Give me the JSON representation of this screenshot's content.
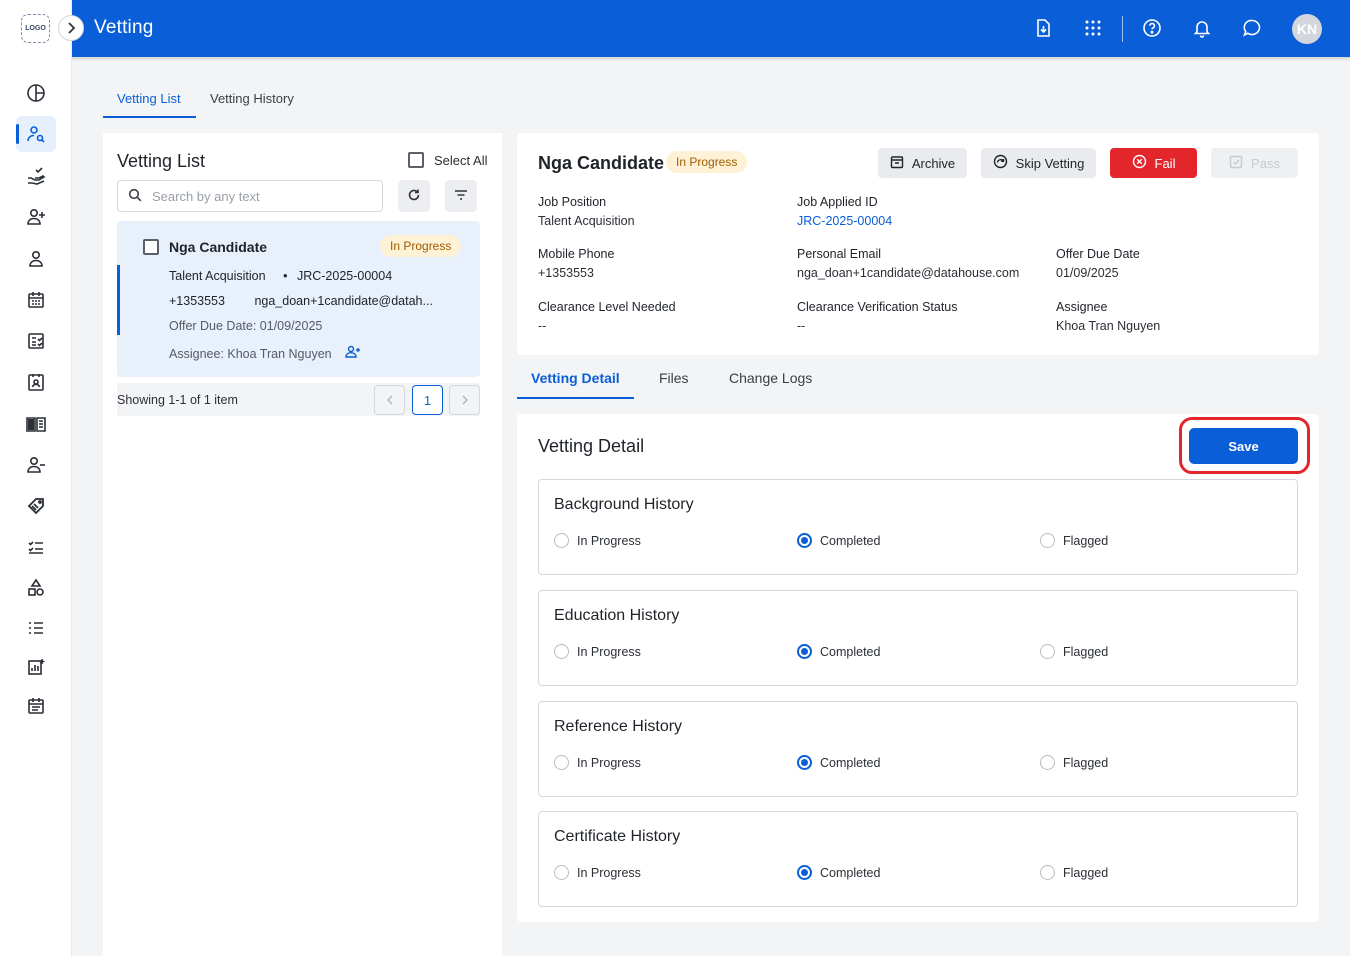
{
  "header": {
    "app_title": "Vetting",
    "logo_text": "LOGO",
    "avatar_initials": "KN",
    "icons": [
      "download-icon",
      "apps-grid-icon",
      "help-icon",
      "bell-icon",
      "chat-icon"
    ]
  },
  "sidebar": {
    "items": [
      "dashboard-icon",
      "candidate-search-icon",
      "hand-check-icon",
      "add-user-icon",
      "person-icon",
      "calendar-icon",
      "checklist-form-icon",
      "id-card-icon",
      "book-icon",
      "remove-user-icon",
      "tag-icon",
      "tasks-icon",
      "shapes-icon",
      "numbered-list-icon",
      "report-icon",
      "event-icon"
    ],
    "active_index": 1
  },
  "page_tabs": {
    "list": "Vetting List",
    "history": "Vetting History"
  },
  "vetting_list": {
    "title": "Vetting List",
    "select_all": "Select All",
    "search_placeholder": "Search by any text",
    "showing": "Showing 1-1 of 1 item",
    "current_page": "1",
    "card": {
      "name": "Nga Candidate",
      "status": "In Progress",
      "position": "Talent Acquisition",
      "bullet": "•",
      "job_id": "JRC-2025-00004",
      "phone": "+1353553",
      "email": "nga_doan+1candidate@datah...",
      "offer_due": "Offer Due Date: 01/09/2025",
      "assignee": "Assignee: Khoa Tran Nguyen"
    }
  },
  "candidate": {
    "name": "Nga Candidate",
    "status": "In Progress",
    "actions": {
      "archive": "Archive",
      "skip": "Skip Vetting",
      "fail": "Fail",
      "pass": "Pass"
    },
    "fields": {
      "job_position_label": "Job Position",
      "job_position": "Talent Acquisition",
      "job_applied_id_label": "Job Applied ID",
      "job_applied_id": "JRC-2025-00004",
      "mobile_label": "Mobile Phone",
      "mobile": "+1353553",
      "email_label": "Personal Email",
      "email": "nga_doan+1candidate@datahouse.com",
      "offer_due_label": "Offer Due Date",
      "offer_due": "01/09/2025",
      "clearance_level_label": "Clearance Level Needed",
      "clearance_level": "--",
      "clearance_status_label": "Clearance Verification Status",
      "clearance_status": "--",
      "assignee_label": "Assignee",
      "assignee": "Khoa Tran Nguyen"
    }
  },
  "detail_tabs": {
    "detail": "Vetting Detail",
    "files": "Files",
    "logs": "Change Logs"
  },
  "vetting_detail": {
    "title": "Vetting Detail",
    "save": "Save",
    "options": [
      "In Progress",
      "Completed",
      "Flagged"
    ],
    "sections": [
      {
        "title": "Background History",
        "selected": "Completed"
      },
      {
        "title": "Education History",
        "selected": "Completed"
      },
      {
        "title": "Reference History",
        "selected": "Completed"
      },
      {
        "title": "Certificate History",
        "selected": "Completed"
      }
    ]
  },
  "colors": {
    "primary": "#0a5ed7",
    "danger": "#e3262b",
    "badge_bg": "#fdf1d6",
    "badge_text": "#a15c00"
  }
}
